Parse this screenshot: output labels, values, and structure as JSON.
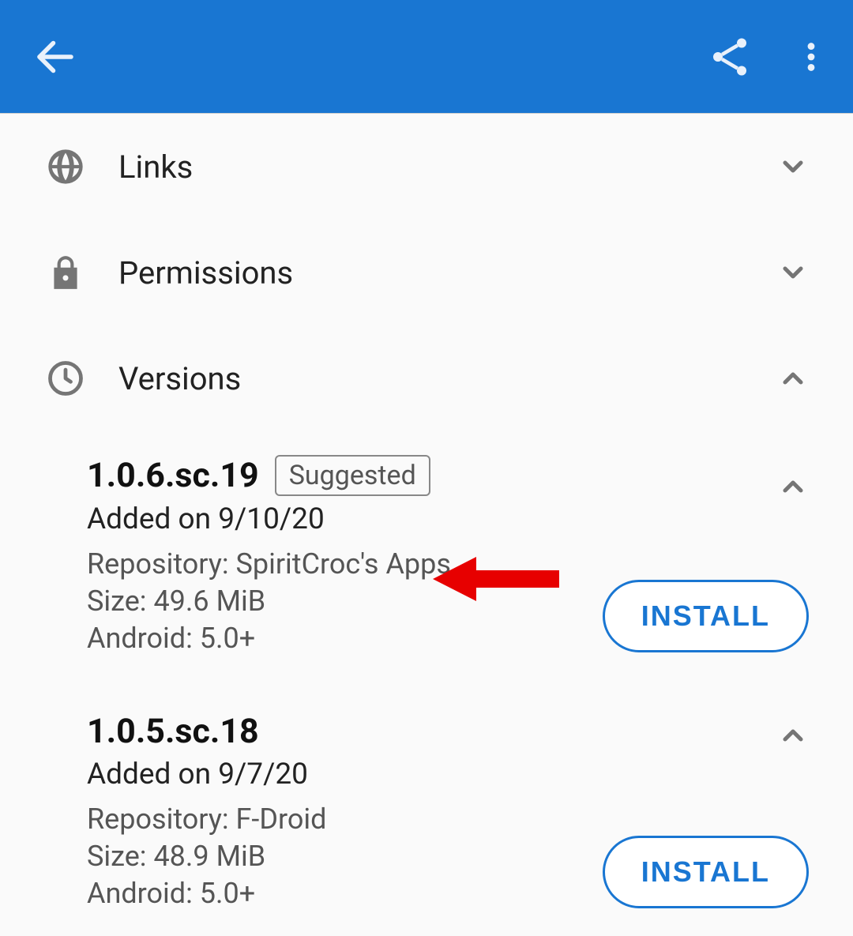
{
  "sections": {
    "links": {
      "label": "Links"
    },
    "permissions": {
      "label": "Permissions"
    },
    "versions": {
      "label": "Versions"
    }
  },
  "versions_list": [
    {
      "name": "1.0.6.sc.19",
      "suggested": true,
      "suggested_label": "Suggested",
      "added": "Added on 9/10/20",
      "repo_line": "Repository: SpiritCroc's Apps",
      "size_line": "Size: 49.6 MiB",
      "android_line": "Android: 5.0+",
      "install_label": "INSTALL"
    },
    {
      "name": "1.0.5.sc.18",
      "suggested": false,
      "added": "Added on 9/7/20",
      "repo_line": "Repository: F-Droid",
      "size_line": "Size: 48.9 MiB",
      "android_line": "Android: 5.0+",
      "install_label": "INSTALL"
    }
  ],
  "annotation": {
    "type": "arrow",
    "target": "repository-line-0"
  }
}
